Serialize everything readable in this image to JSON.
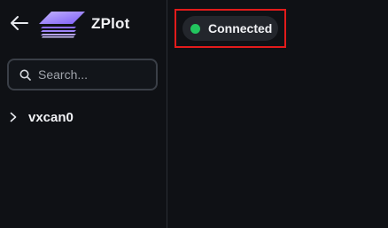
{
  "app": {
    "title": "ZPlot"
  },
  "search": {
    "placeholder": "Search...",
    "value": ""
  },
  "tree": {
    "items": [
      {
        "label": "vxcan0",
        "expanded": false,
        "icon": "chevron-right-icon"
      }
    ]
  },
  "status": {
    "label": "Connected",
    "dot_color": "#22c55e",
    "highlight_color": "#e21b1b"
  },
  "icons": {
    "back": "arrow-left-icon",
    "logo": "zplot-logo-icon",
    "search": "search-icon"
  },
  "colors": {
    "background": "#0f1115",
    "logo_top": "#a78bfa",
    "logo_bottom": "#7c5cf6"
  }
}
